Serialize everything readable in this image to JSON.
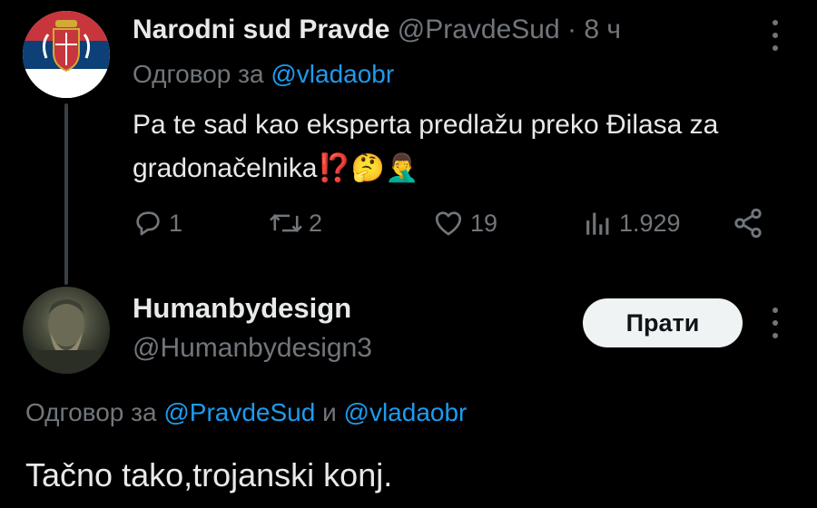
{
  "tweet": {
    "author_name": "Narodni sud Pravde",
    "author_handle": "@PravdeSud",
    "separator": " · ",
    "time": "8 ч",
    "reply_prefix": "Одговор за",
    "reply_to": "@vladaobr",
    "text": "Pa te sad kao eksperta predlažu preko Đilasa za gradonačelnika⁉️🤔🤦‍♂️",
    "stats": {
      "replies": "1",
      "reposts": "2",
      "likes": "19",
      "views": "1.929"
    },
    "icons": {
      "reply": "reply-icon",
      "repost": "repost-icon",
      "like": "heart-icon",
      "views": "views-icon",
      "share": "share-icon",
      "more": "more-icon"
    },
    "avatar": "serbian-flag-avatar"
  },
  "reply": {
    "author_name": "Humanbydesign",
    "author_handle": "@Humanbydesign3",
    "follow_label": "Прати",
    "reply_prefix": "Одговор за",
    "reply_to_1": "@PravdeSud",
    "conjunction": "и",
    "reply_to_2": "@vladaobr",
    "text": "Tačno tako,trojanski konj.",
    "avatar": "warrior-portrait-avatar"
  },
  "colors": {
    "background": "#000000",
    "text": "#e7e9ea",
    "muted": "#71767b",
    "link": "#1d9bf0",
    "button_bg": "#eff3f4"
  }
}
